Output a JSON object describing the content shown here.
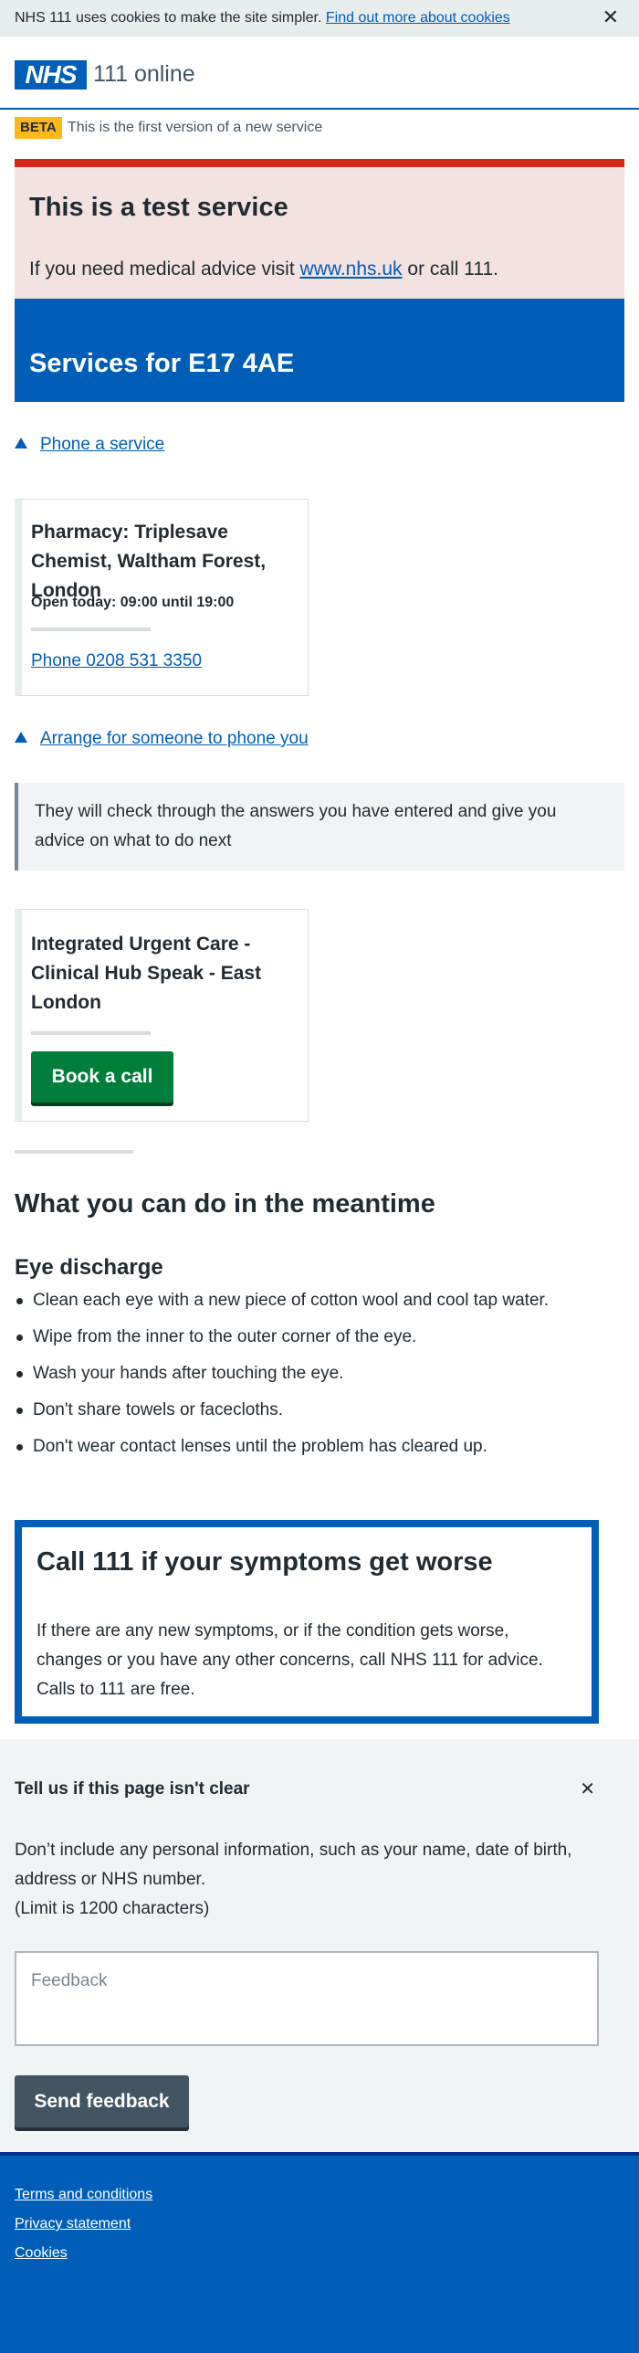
{
  "cookie_banner": {
    "text": "NHS 111 uses cookies to make the site simpler.",
    "link": "Find out more about cookies",
    "close": "✕"
  },
  "header": {
    "logo": "NHS",
    "service_name": "111 online"
  },
  "beta": {
    "tag": "BETA",
    "text": "This is the first version of a new service"
  },
  "test_notice": {
    "title": "This is a test service",
    "text_before": "If you need medical advice visit",
    "link": "www.nhs.uk",
    "text_after": "or call 111."
  },
  "services": {
    "title": "Services for E17 4AE"
  },
  "phone_section": {
    "toggle": "Phone a service",
    "card": {
      "title": "Pharmacy: Triplesave Chemist, Waltham Forest, London",
      "opening": "Open today: 09:00 until 19:00",
      "phone": "Phone 0208 531 3350"
    }
  },
  "callback_section": {
    "toggle": "Arrange for someone to phone you",
    "inset": "They will check through the answers you have entered and give you advice on what to do next",
    "card": {
      "title": "Integrated Urgent Care - Clinical Hub Speak - East London",
      "button": "Book a call"
    }
  },
  "meantime": {
    "title": "What you can do in the meantime",
    "subtitle": "Eye discharge",
    "items": [
      "Clean each eye with a new piece of cotton wool and cool tap water.",
      "Wipe from the inner to the outer corner of the eye.",
      "Wash your hands after touching the eye.",
      "Don't share towels or facecloths.",
      "Don't wear contact lenses until the problem has cleared up."
    ]
  },
  "care_card": {
    "title": "Call 111 if your symptoms get worse",
    "text": "If there are any new symptoms, or if the condition gets worse, changes or you have any other concerns, call NHS 111 for advice. Calls to 111 are free."
  },
  "feedback": {
    "title": "Tell us if this page isn't clear",
    "close": "✕",
    "text": "Don’t include any personal information, such as your name, date of birth, address or NHS number.",
    "limit": "(Limit is 1200 characters)",
    "placeholder": "Feedback",
    "button": "Send feedback"
  },
  "footer": {
    "links": [
      "Terms and conditions",
      "Privacy statement",
      "Cookies"
    ]
  }
}
